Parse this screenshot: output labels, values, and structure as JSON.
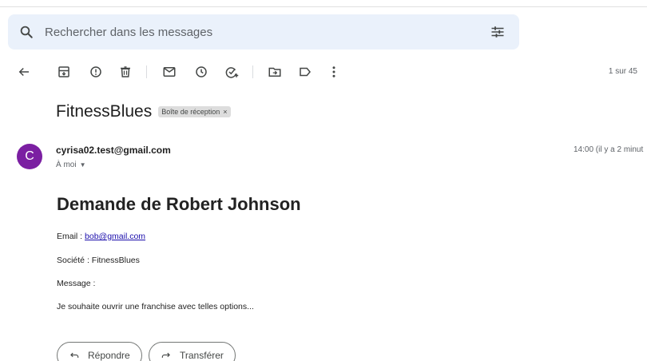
{
  "search": {
    "placeholder": "Rechercher dans les messages"
  },
  "toolbar": {
    "pager": "1 sur 45",
    "icons": [
      "back-arrow-icon",
      "archive-icon",
      "report-spam-icon",
      "delete-icon",
      "mark-unread-icon",
      "snooze-icon",
      "add-task-icon",
      "move-to-icon",
      "label-icon",
      "more-icon"
    ]
  },
  "email": {
    "subject": "FitnessBlues",
    "label": "Boîte de réception",
    "label_close": "×",
    "avatar_letter": "C",
    "sender": "cyrisa02.test@gmail.com",
    "recipient": "À moi",
    "time": "14:00 (il y a 2 minut",
    "heading": "Demande de Robert Johnson",
    "email_label": "Email : ",
    "email_value": "bob@gmail.com",
    "company_line": "Société : FitnessBlues",
    "message_label": "Message :",
    "message_body": "Je souhaite ouvrir une franchise avec telles options..."
  },
  "actions": {
    "reply": "Répondre",
    "forward": "Transférer"
  },
  "colors": {
    "search_bg": "#eaf1fb",
    "avatar_bg": "#7b1fa2",
    "link": "#1a0dab"
  }
}
